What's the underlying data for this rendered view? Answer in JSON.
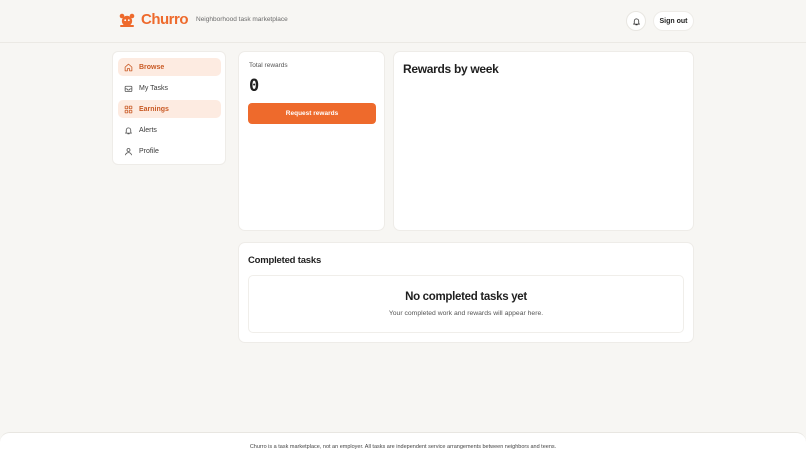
{
  "app": {
    "name": "Churro",
    "tagline": "Neighborhood task marketplace"
  },
  "header": {
    "notifications_icon": "bell-icon",
    "sign_out_label": "Sign out"
  },
  "sidebar": {
    "items": [
      {
        "label": "Browse",
        "icon": "home-icon",
        "active": true
      },
      {
        "label": "My Tasks",
        "icon": "inbox-icon",
        "active": false
      },
      {
        "label": "Earnings",
        "icon": "grid-icon",
        "active": true
      },
      {
        "label": "Alerts",
        "icon": "bell-icon",
        "active": false
      },
      {
        "label": "Profile",
        "icon": "user-icon",
        "active": false
      }
    ]
  },
  "rewards": {
    "label": "Total rewards",
    "value": "0",
    "request_label": "Request rewards"
  },
  "chart": {
    "title": "Rewards by week"
  },
  "completed": {
    "title": "Completed tasks",
    "empty_title": "No completed tasks yet",
    "empty_subtitle": "Your completed work and rewards will appear here."
  },
  "footer": {
    "text": "Churro is a task marketplace, not an employer. All tasks are independent service arrangements between neighbors and teens."
  },
  "colors": {
    "accent": "#ee6a2c",
    "accent_soft": "#fdebe1",
    "background": "#f7f6f3",
    "card": "#ffffff"
  }
}
